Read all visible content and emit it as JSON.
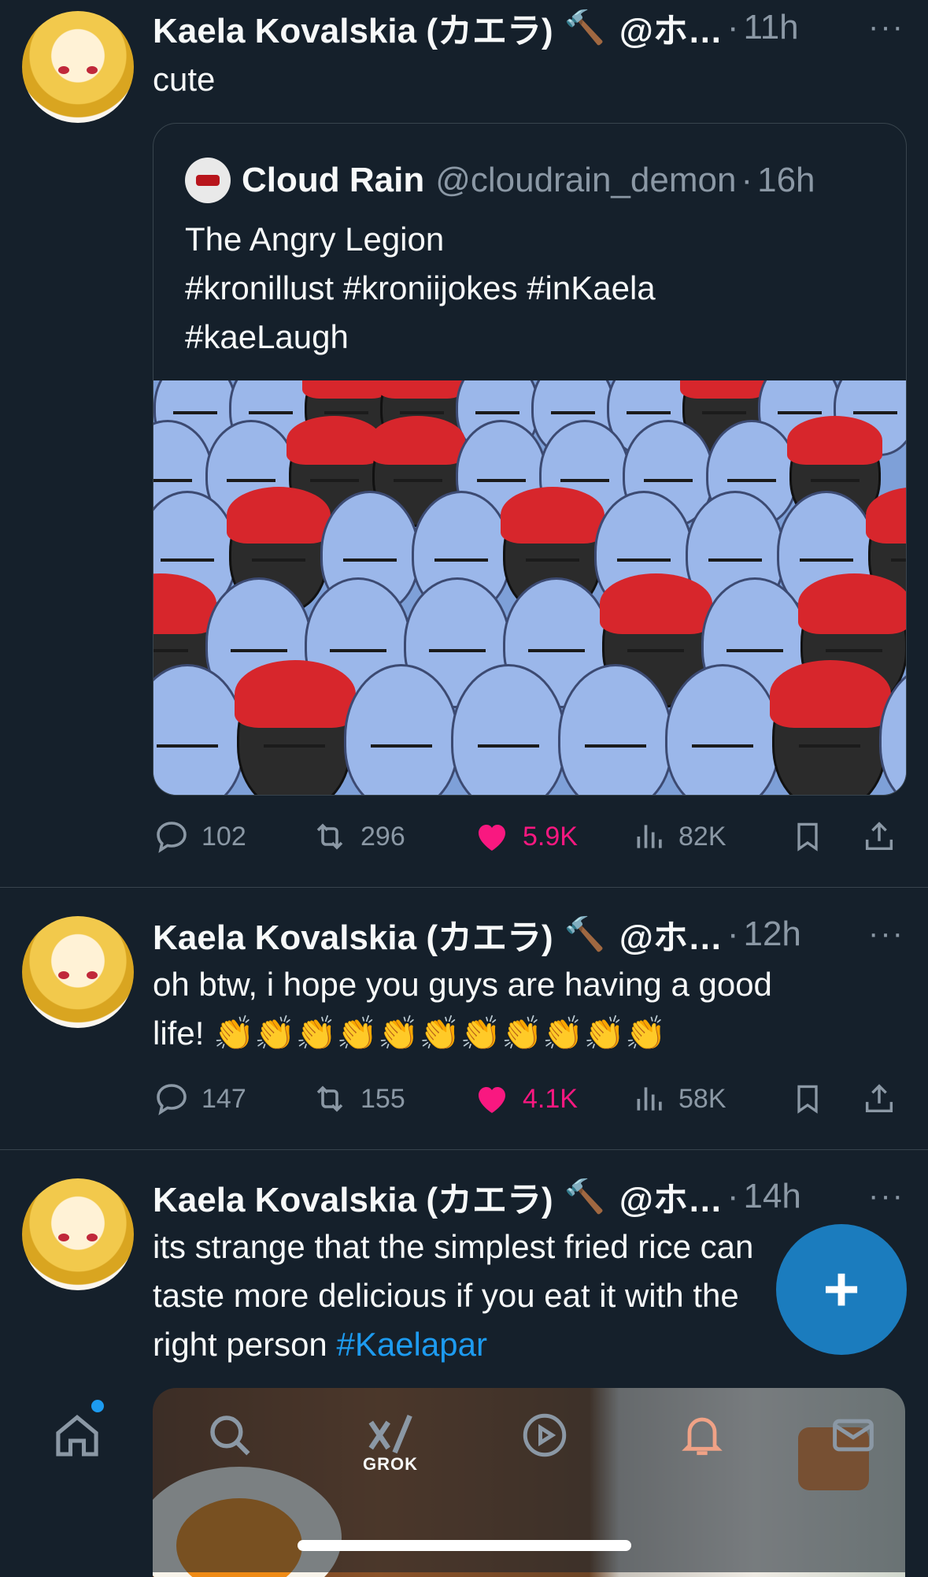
{
  "tweets": [
    {
      "name": "Kaela Kovalskia (カエラ)",
      "hammer": "🔨",
      "handle": "@ホ…",
      "time": "11h",
      "text": "cute",
      "quote": {
        "name": "Cloud Rain",
        "handle": "@cloudrain_demon",
        "time": "16h",
        "lines": [
          "The Angry Legion",
          "#kronillust #kroniijokes #inKaela",
          "#kaeLaugh"
        ]
      },
      "replies": "102",
      "retweets": "296",
      "likes": "5.9K",
      "views": "82K"
    },
    {
      "name": "Kaela Kovalskia (カエラ)",
      "hammer": "🔨",
      "handle": "@ホ…",
      "time": "12h",
      "line1": "oh btw, i hope you guys are having a good",
      "line2": "life! 👏👏👏👏👏👏👏👏👏👏👏",
      "replies": "147",
      "retweets": "155",
      "likes": "4.1K",
      "views": "58K"
    },
    {
      "name": "Kaela Kovalskia (カエラ)",
      "hammer": "🔨",
      "handle": "@ホ…",
      "time": "14h",
      "line1": "its strange that the simplest fried rice can",
      "line2": "taste more delicious if you eat it with the",
      "line3": "right person ",
      "hashtag": "#Kaelapar"
    }
  ],
  "separator": "·",
  "more": "···",
  "fab_label": "+",
  "nav": {
    "grok_label": "GROK"
  },
  "colors": {
    "background": "#15202b",
    "accent": "#1d9bf0",
    "like": "#f91880",
    "muted": "#8b98a5"
  },
  "icons": [
    "home-icon",
    "search-icon",
    "grok-icon",
    "video-icon",
    "bell-icon",
    "mail-icon",
    "reply-icon",
    "retweet-icon",
    "heart-icon",
    "views-icon",
    "bookmark-icon",
    "share-icon"
  ]
}
